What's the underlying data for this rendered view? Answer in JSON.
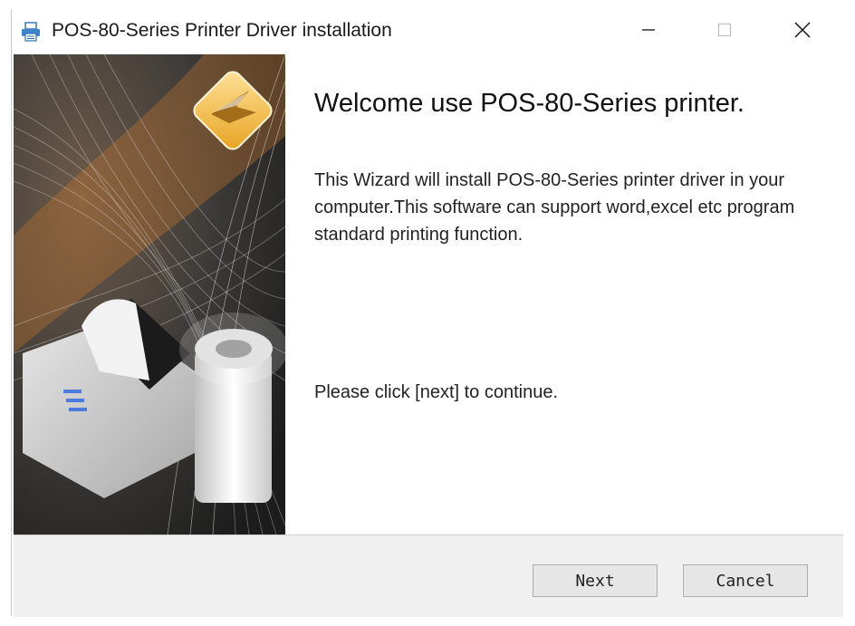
{
  "window": {
    "title": "POS-80-Series Printer Driver installation",
    "title_icon": "printer-icon",
    "controls": {
      "minimize_icon": "minimize-icon",
      "maximize_icon": "maximize-icon",
      "close_icon": "close-icon"
    }
  },
  "banner": {
    "image": "printer-with-paper-roll-graphic",
    "logo_icon": "diamond-logo-icon"
  },
  "content": {
    "heading": "Welcome use POS-80-Series printer.",
    "description": "This Wizard will install POS-80-Series printer driver in your computer.This software can support word,excel etc program standard printing function.",
    "instruction": "Please click [next] to continue."
  },
  "footer": {
    "next_label": "Next",
    "cancel_label": "Cancel"
  },
  "colors": {
    "footer_bg": "#f0f0f0",
    "logo_gold": "#f2b233",
    "button_bg": "#e6e6e6"
  }
}
